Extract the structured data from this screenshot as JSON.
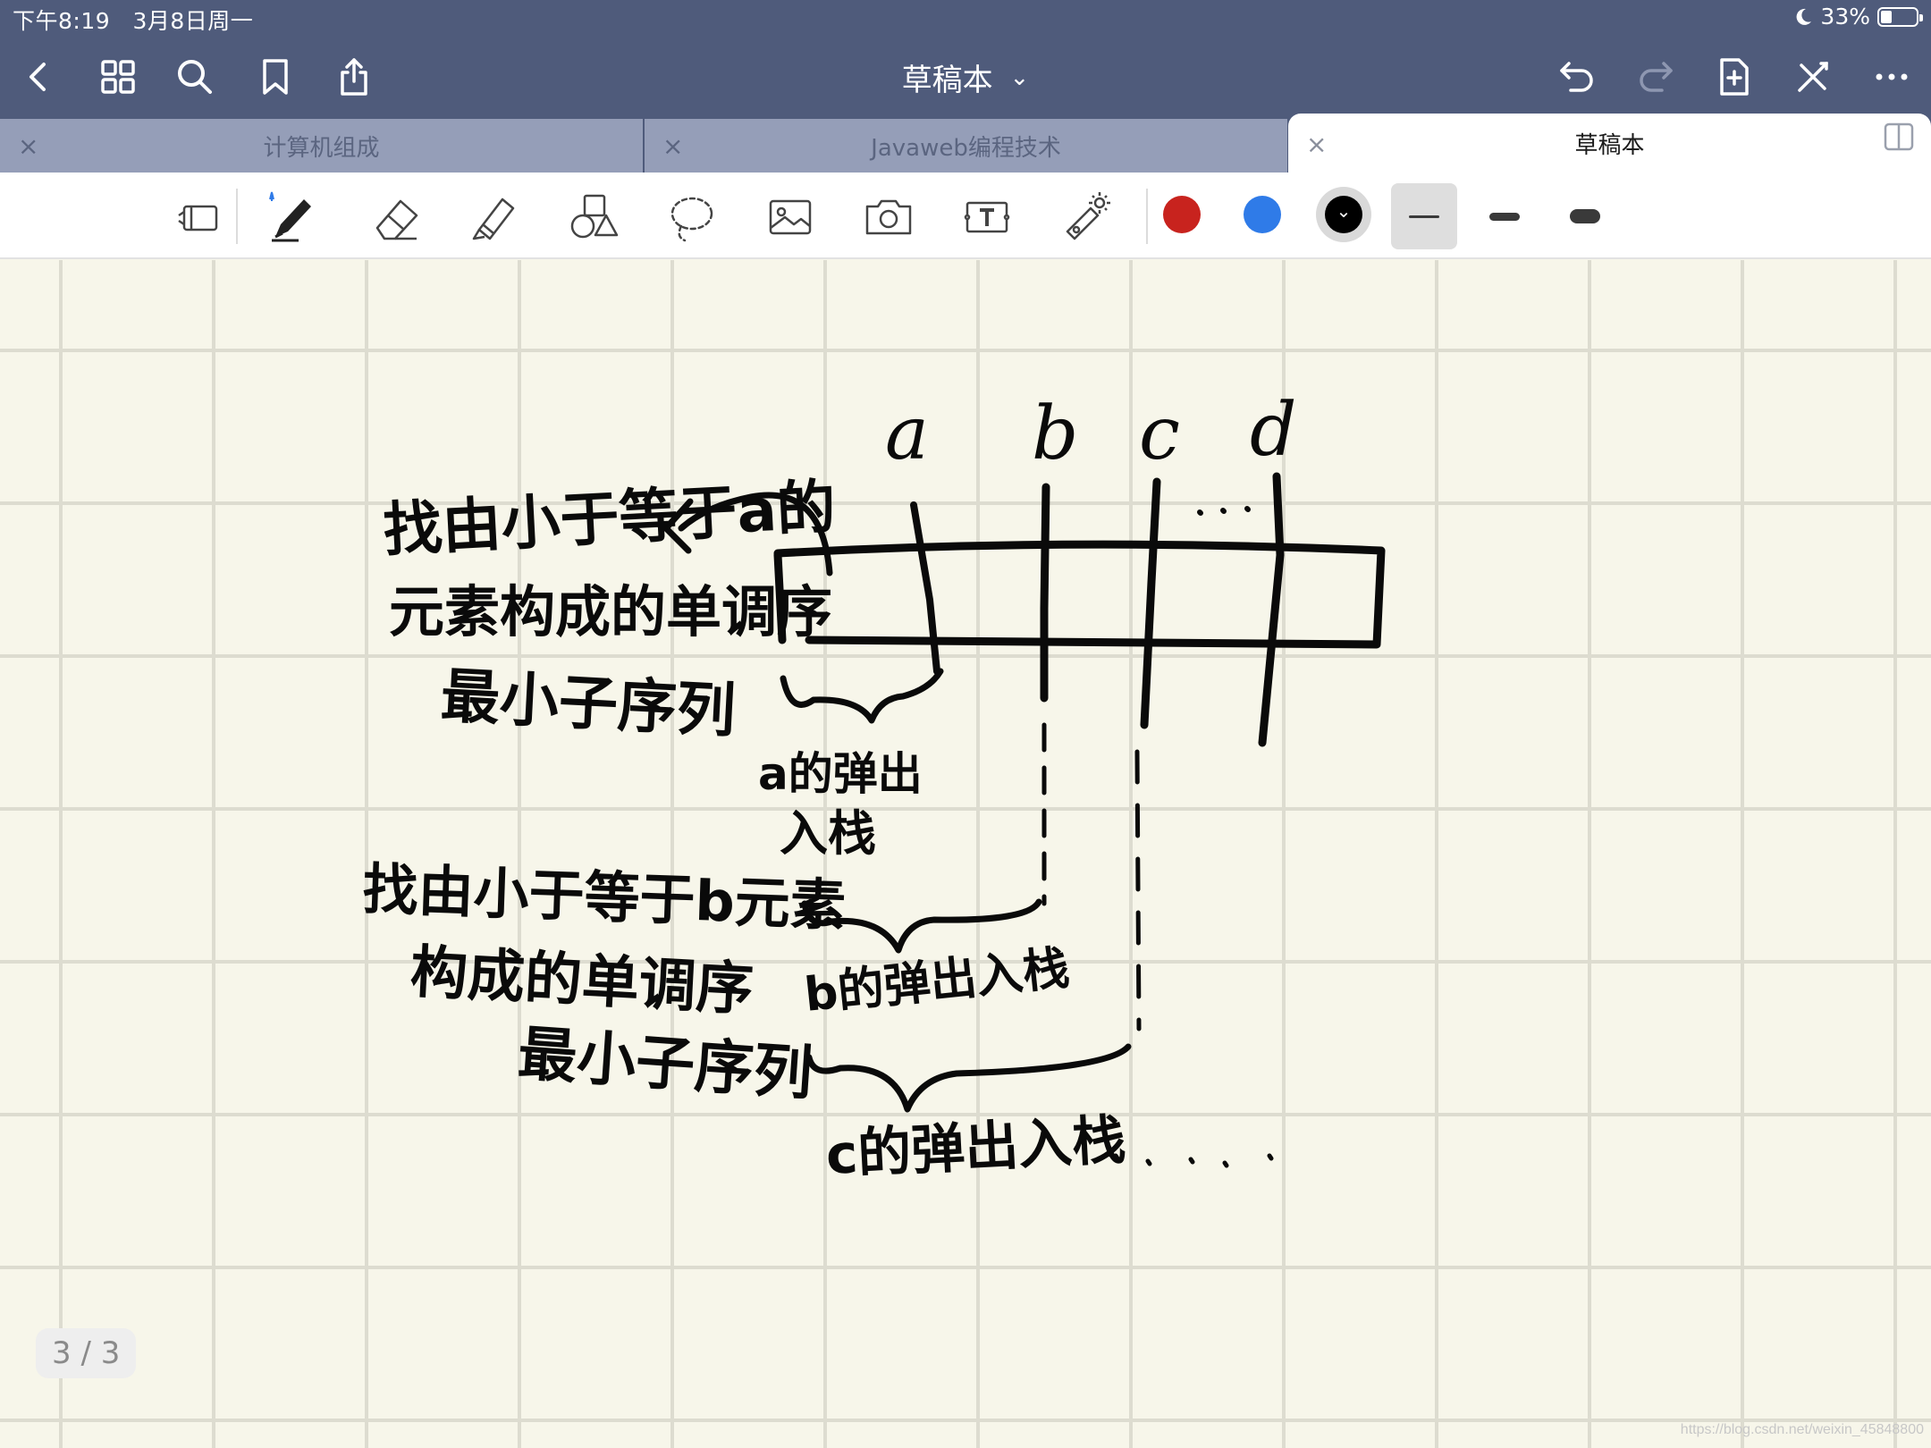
{
  "status": {
    "time": "下午8:19",
    "date": "3月8日周一",
    "battery": "33%",
    "icons": [
      "moon-icon",
      "battery-icon"
    ]
  },
  "nav": {
    "title": "草稿本",
    "title_chevron": "⌄",
    "left_icons": [
      "back-icon",
      "grid-icon",
      "search-icon",
      "bookmark-icon",
      "share-icon"
    ],
    "right_icons": [
      "undo-icon",
      "redo-icon",
      "add-page-icon",
      "close-pen-icon",
      "more-icon"
    ]
  },
  "tabs": [
    {
      "label": "计算机组成",
      "active": false
    },
    {
      "label": "Javaweb编程技术",
      "active": false
    },
    {
      "label": "草稿本",
      "active": true
    }
  ],
  "tab_close_glyph": "×",
  "toolbar": {
    "tools": [
      "sidebar-toggle-icon",
      "pen-icon",
      "eraser-icon",
      "highlighter-icon",
      "shapes-icon",
      "lasso-icon",
      "image-icon",
      "camera-icon",
      "text-icon",
      "laser-pointer-icon"
    ],
    "colors": [
      "#c8231e",
      "#2f7be8",
      "#000000"
    ],
    "selected_color": "#000000",
    "stroke_widths": [
      "thin",
      "medium",
      "thick"
    ],
    "selected_stroke": "thin"
  },
  "canvas": {
    "page_indicator": "3 / 3",
    "watermark": "https://blog.csdn.net/weixin_45848800",
    "handwriting": {
      "column_labels": [
        "a",
        "b",
        "c",
        "d"
      ],
      "note1": [
        "找由小于等于a的",
        "元素构成的单调序",
        "最小子序列"
      ],
      "note2": [
        "找由小于等于b元素",
        "构成的单调序",
        "最小子序列"
      ],
      "label_a": [
        "a的弹出",
        "入栈"
      ],
      "label_b": "b的弹出入栈",
      "label_c": "c的弹出入栈",
      "ellipsis": "· · ·",
      "ellipsis_bottom": "· · · · ·"
    }
  }
}
